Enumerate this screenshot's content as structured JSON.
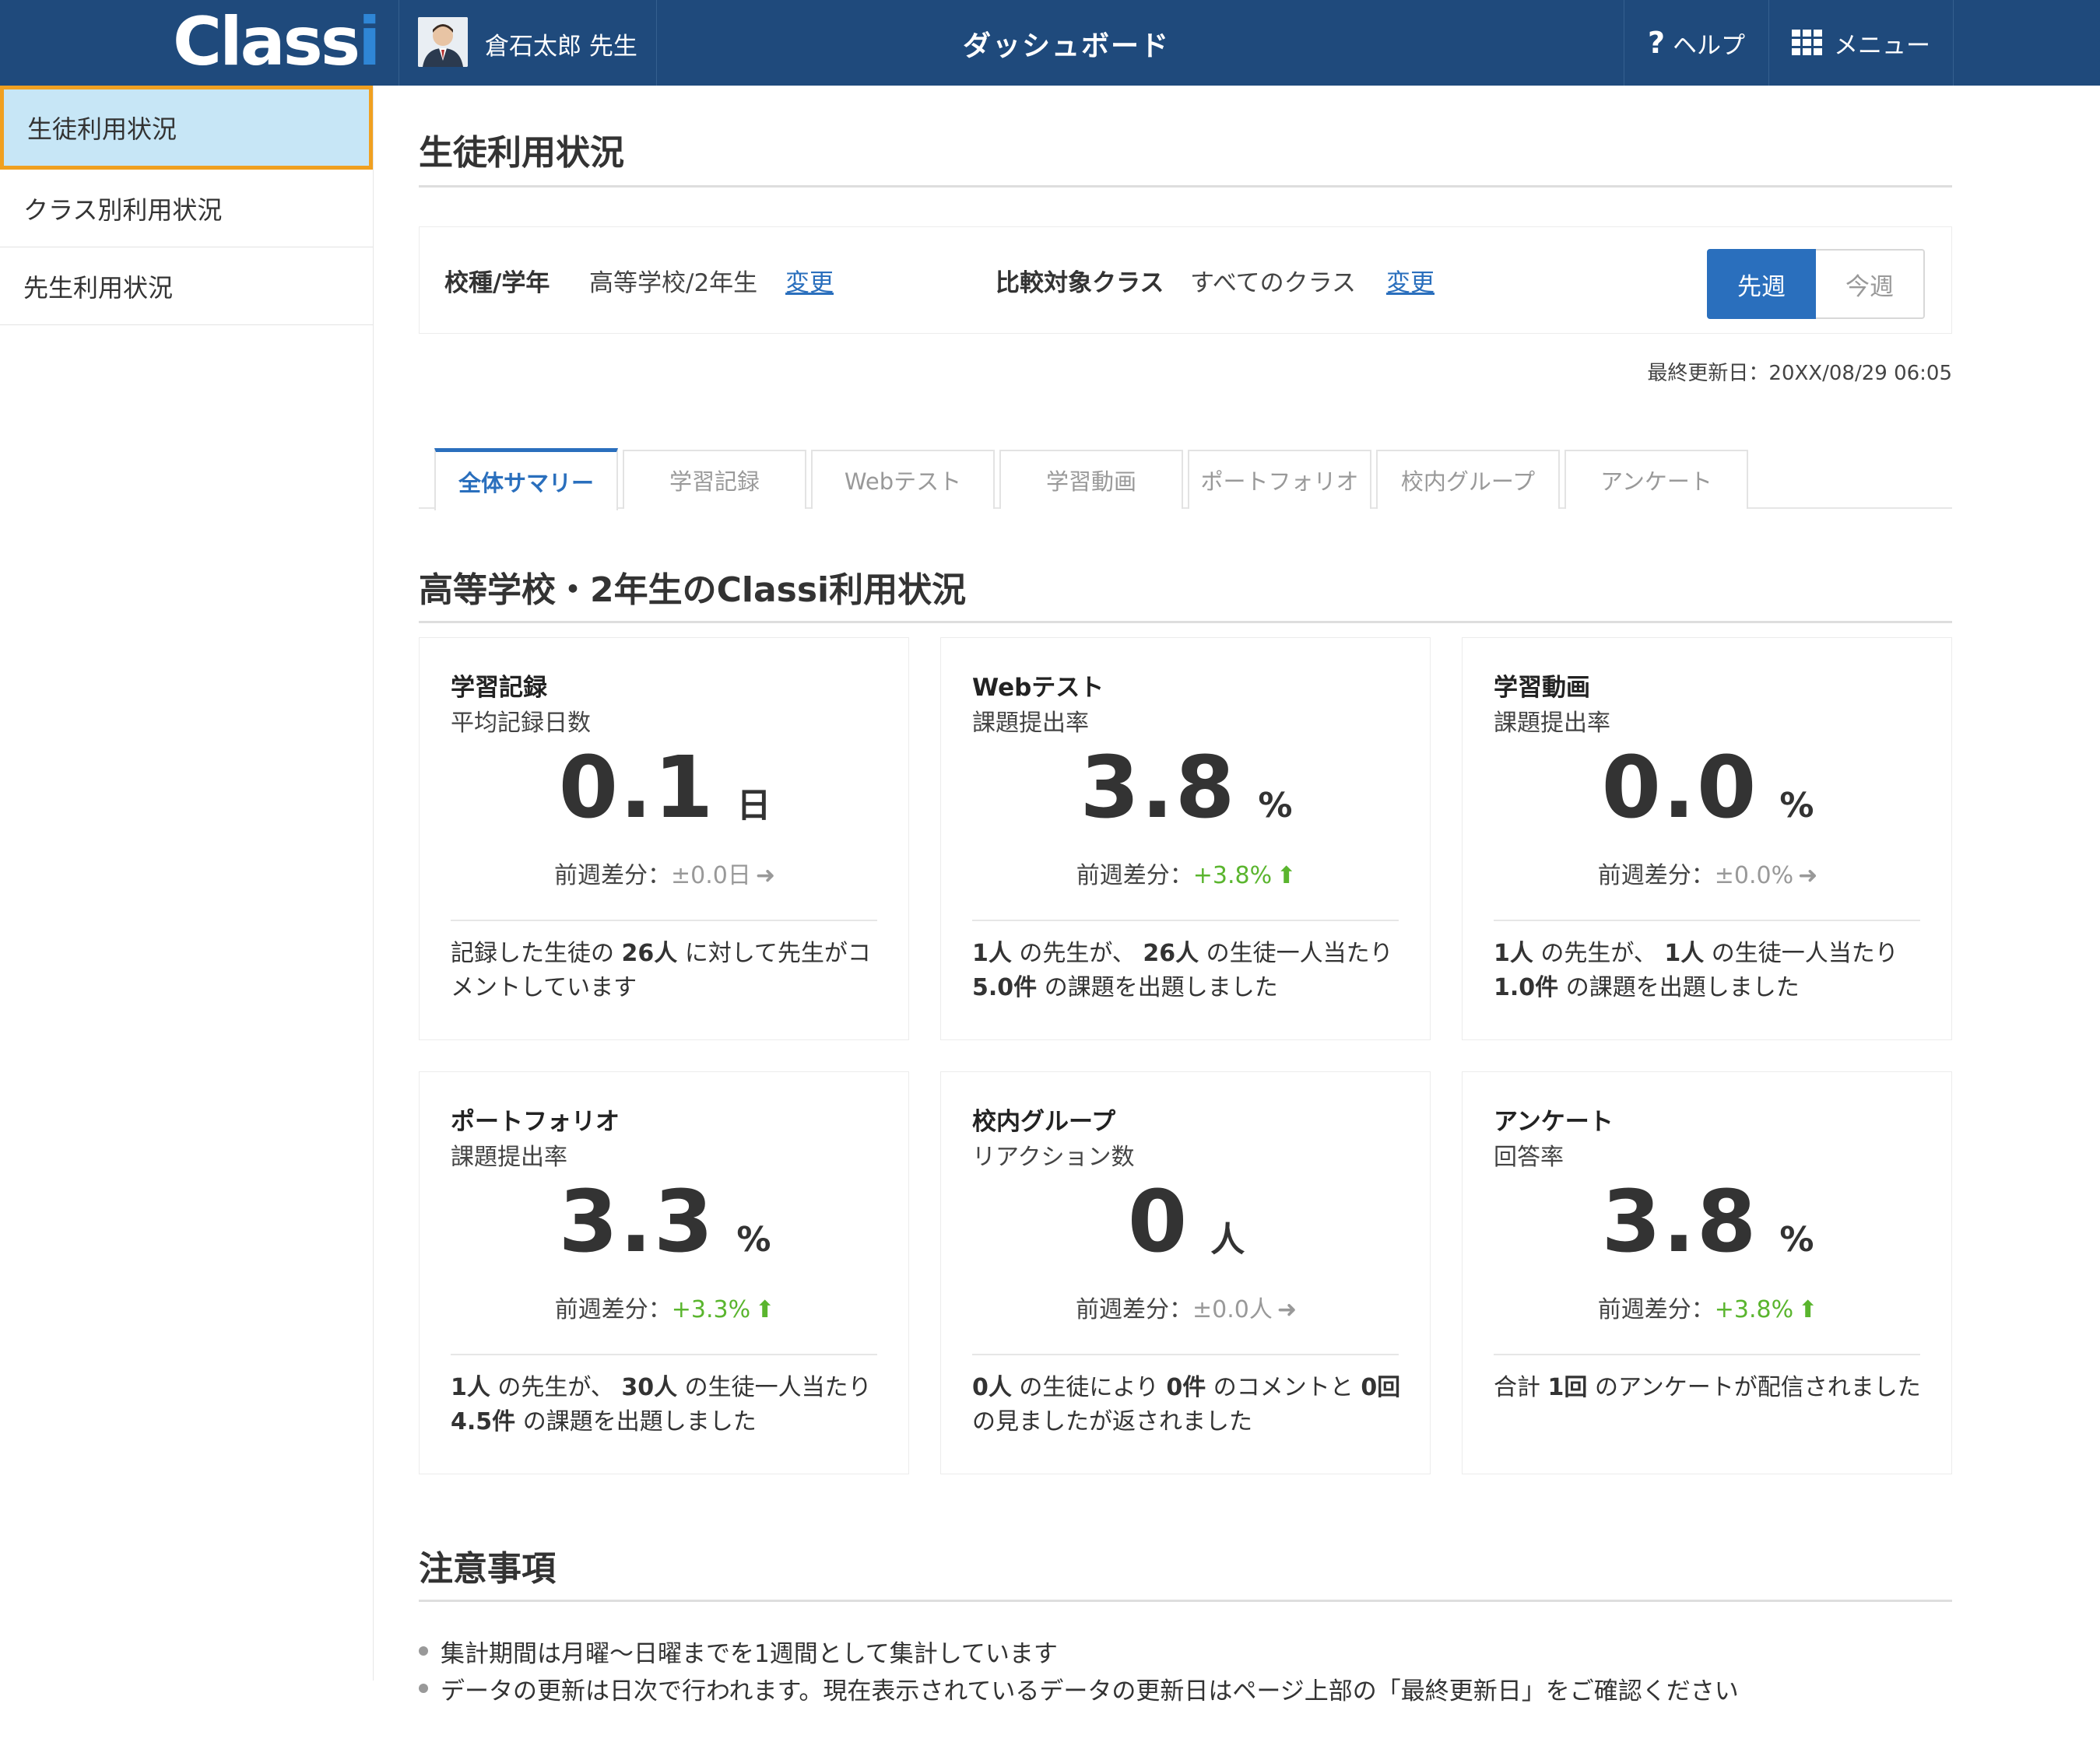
{
  "header": {
    "logo": "Classi",
    "user_name": "倉石太郎 先生",
    "title": "ダッシュボード",
    "help_label": "ヘルプ",
    "menu_label": "メニュー"
  },
  "sidebar": {
    "items": [
      {
        "label": "生徒利用状況"
      },
      {
        "label": "クラス別利用状況"
      },
      {
        "label": "先生利用状況"
      }
    ]
  },
  "main": {
    "page_title": "生徒利用状況",
    "filter": {
      "grade_label": "校種/学年",
      "grade_value": "高等学校/2年生",
      "grade_change": "変更",
      "compare_label": "比較対象クラス",
      "compare_value": "すべてのクラス",
      "compare_change": "変更",
      "week_last": "先週",
      "week_this": "今週"
    },
    "last_updated": "最終更新日：20XX/08/29 06:05",
    "tabs": [
      {
        "label": "全体サマリー"
      },
      {
        "label": "学習記録"
      },
      {
        "label": "Webテスト"
      },
      {
        "label": "学習動画"
      },
      {
        "label": "ポートフォリオ"
      },
      {
        "label": "校内グループ"
      },
      {
        "label": "アンケート"
      }
    ],
    "section_title": "高等学校・2年生のClassi利用状況",
    "diff_prefix": "前週差分：",
    "cards": [
      {
        "title": "学習記録",
        "subtitle": "平均記録日数",
        "value": "0.1",
        "unit": "日",
        "diff": "±0.0日",
        "arrow": "➜",
        "desc": [
          "記録した生徒の ",
          "26人",
          " に対して先生がコメントしています"
        ]
      },
      {
        "title": "Webテスト",
        "subtitle": "課題提出率",
        "value": "3.8",
        "unit": "%",
        "diff": "+3.8%",
        "arrow": "⬆",
        "desc": [
          "1人",
          " の先生が、 ",
          "26人",
          " の生徒一人当たり ",
          "5.0件",
          " の課題を出題しました"
        ]
      },
      {
        "title": "学習動画",
        "subtitle": "課題提出率",
        "value": "0.0",
        "unit": "%",
        "diff": "±0.0%",
        "arrow": "➜",
        "desc": [
          "1人",
          " の先生が、 ",
          "1人",
          " の生徒一人当たり ",
          "1.0件",
          " の課題を出題しました"
        ]
      },
      {
        "title": "ポートフォリオ",
        "subtitle": "課題提出率",
        "value": "3.3",
        "unit": "%",
        "diff": "+3.3%",
        "arrow": "⬆",
        "desc": [
          "1人",
          " の先生が、 ",
          "30人",
          " の生徒一人当たり ",
          "4.5件",
          " の課題を出題しました"
        ]
      },
      {
        "title": "校内グループ",
        "subtitle": "リアクション数",
        "value": "0",
        "unit": "人",
        "diff": "±0.0人",
        "arrow": "➜",
        "desc": [
          "0人",
          " の生徒により ",
          "0件",
          " のコメントと ",
          "0回",
          " の見ましたが返されました"
        ]
      },
      {
        "title": "アンケート",
        "subtitle": "回答率",
        "value": "3.8",
        "unit": "%",
        "diff": "+3.8%",
        "arrow": "⬆",
        "desc": [
          "合計 ",
          "1回",
          " のアンケートが配信されました"
        ]
      }
    ],
    "notes_title": "注意事項",
    "notes": [
      "集計期間は月曜〜日曜までを1週間として集計しています",
      "データの更新は日次で行われます。現在表示されているデータの更新日はページ上部の「最終更新日」をご確認ください"
    ]
  },
  "colors": {
    "header_bg": "#1f4a7c",
    "accent_blue": "#2a6fbd",
    "active_sidebar_bg": "#c7e6f6",
    "active_sidebar_border": "#f0a020",
    "diff_up": "#5ab52e",
    "diff_flat": "#999999"
  },
  "icons": {
    "help": "question-mark-icon",
    "menu": "grid-icon",
    "arrow_flat": "arrow-right-icon",
    "arrow_up": "arrow-up-icon"
  }
}
